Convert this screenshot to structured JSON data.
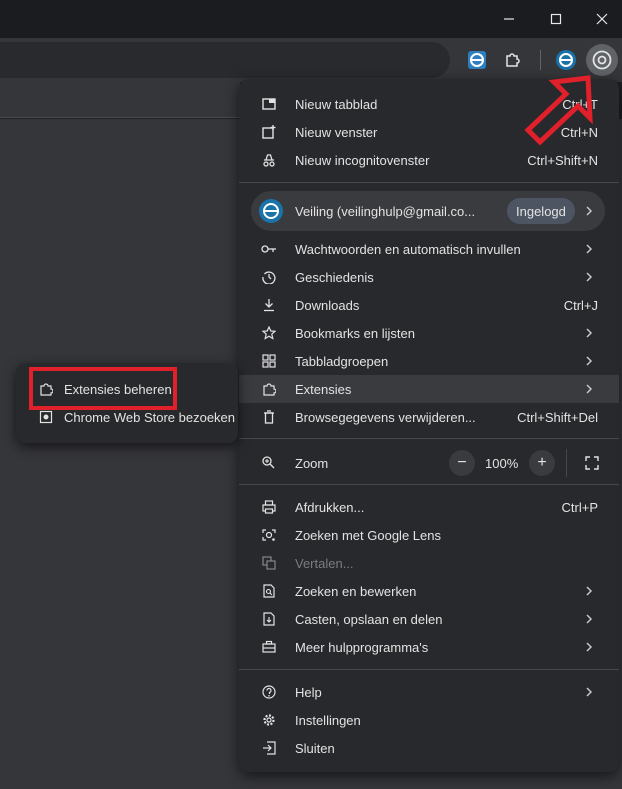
{
  "window": {
    "controls": {
      "minimize_icon": "minimize-icon",
      "maximize_icon": "maximize-icon",
      "close_icon": "close-icon"
    }
  },
  "menu": {
    "group1": [
      {
        "label": "Nieuw tabblad",
        "shortcut": "Ctrl+T",
        "icon": "new-tab-icon"
      },
      {
        "label": "Nieuw venster",
        "shortcut": "Ctrl+N",
        "icon": "new-window-icon"
      },
      {
        "label": "Nieuw incognitovenster",
        "shortcut": "Ctrl+Shift+N",
        "icon": "incognito-icon"
      }
    ],
    "profile": {
      "name": "Veiling (veilinghulp@gmail.co...",
      "badge": "Ingelogd"
    },
    "group2": [
      {
        "label": "Wachtwoorden en automatisch invullen",
        "shortcut": "",
        "icon": "key-icon",
        "submenu": true
      },
      {
        "label": "Geschiedenis",
        "shortcut": "",
        "icon": "history-icon",
        "submenu": true
      },
      {
        "label": "Downloads",
        "shortcut": "Ctrl+J",
        "icon": "download-icon",
        "submenu": false
      },
      {
        "label": "Bookmarks en lijsten",
        "shortcut": "",
        "icon": "star-icon",
        "submenu": true
      },
      {
        "label": "Tabbladgroepen",
        "shortcut": "",
        "icon": "tab-groups-icon",
        "submenu": true
      },
      {
        "label": "Extensies",
        "shortcut": "",
        "icon": "puzzle-icon",
        "submenu": true
      },
      {
        "label": "Browsegegevens verwijderen...",
        "shortcut": "Ctrl+Shift+Del",
        "icon": "trash-icon",
        "submenu": false
      }
    ],
    "zoom": {
      "label": "Zoom",
      "value": "100%",
      "minus": "−",
      "plus": "+"
    },
    "group3": [
      {
        "label": "Afdrukken...",
        "shortcut": "Ctrl+P",
        "icon": "print-icon",
        "submenu": false,
        "disabled": false
      },
      {
        "label": "Zoeken met Google Lens",
        "shortcut": "",
        "icon": "lens-icon",
        "submenu": false,
        "disabled": false
      },
      {
        "label": "Vertalen...",
        "shortcut": "",
        "icon": "translate-icon",
        "submenu": false,
        "disabled": true
      },
      {
        "label": "Zoeken en bewerken",
        "shortcut": "",
        "icon": "find-icon",
        "submenu": true,
        "disabled": false
      },
      {
        "label": "Casten, opslaan en delen",
        "shortcut": "",
        "icon": "cast-icon",
        "submenu": true,
        "disabled": false
      },
      {
        "label": "Meer hulpprogramma's",
        "shortcut": "",
        "icon": "toolbox-icon",
        "submenu": true,
        "disabled": false
      }
    ],
    "group4": [
      {
        "label": "Help",
        "shortcut": "",
        "icon": "help-icon",
        "submenu": true
      },
      {
        "label": "Instellingen",
        "shortcut": "",
        "icon": "gear-icon",
        "submenu": false
      },
      {
        "label": "Sluiten",
        "shortcut": "",
        "icon": "exit-icon",
        "submenu": false
      }
    ]
  },
  "submenu": {
    "items": [
      {
        "label": "Extensies beheren",
        "icon": "puzzle-icon"
      },
      {
        "label": "Chrome Web Store bezoeken",
        "icon": "web-store-icon"
      }
    ]
  },
  "colors": {
    "menu_bg": "#28292c",
    "highlight": "#e0202a",
    "hover": "#3a3b3f"
  }
}
